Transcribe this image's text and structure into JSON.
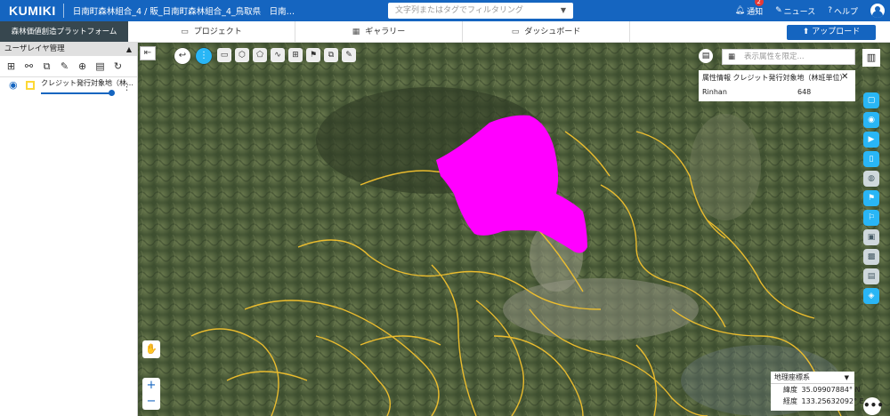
{
  "header": {
    "logo": "KUMIKI",
    "breadcrumb": "日南町森林組合_4 / 販_日南町森林組合_4_鳥取県　日南…",
    "search_placeholder": "文字列またはタグでフィルタリング",
    "notifications_label": "通知",
    "notifications_count": "2",
    "news_label": "ニュース",
    "help_label": "ヘルプ"
  },
  "nav": {
    "platform": "森林価値創造プラットフォーム",
    "tabs": [
      {
        "label": "プロジェクト",
        "icon": "folder-icon"
      },
      {
        "label": "ギャラリー",
        "icon": "grid-icon"
      },
      {
        "label": "ダッシュボード",
        "icon": "monitor-icon"
      }
    ],
    "upload_label": "アップロード"
  },
  "layer_panel": {
    "title": "ユーザレイヤ管理",
    "layers": [
      {
        "name": "クレジット発行対象地（林…",
        "color": "#fdd835",
        "opacity": 1.0
      }
    ]
  },
  "map": {
    "attr_search_placeholder": "表示属性を限定...",
    "attr_panel": {
      "title": "属性情報 クレジット発行対象地（林班単位）",
      "key": "Rinhan",
      "value": "648"
    },
    "coordinate_system": {
      "label": "地理座標系",
      "lat_label": "緯度",
      "lat_value": "35.09907884° N",
      "lon_label": "経度",
      "lon_value": "133.25632092° E"
    },
    "highlight_color": "#ff00ff",
    "boundary_color": "#f2c12e"
  }
}
